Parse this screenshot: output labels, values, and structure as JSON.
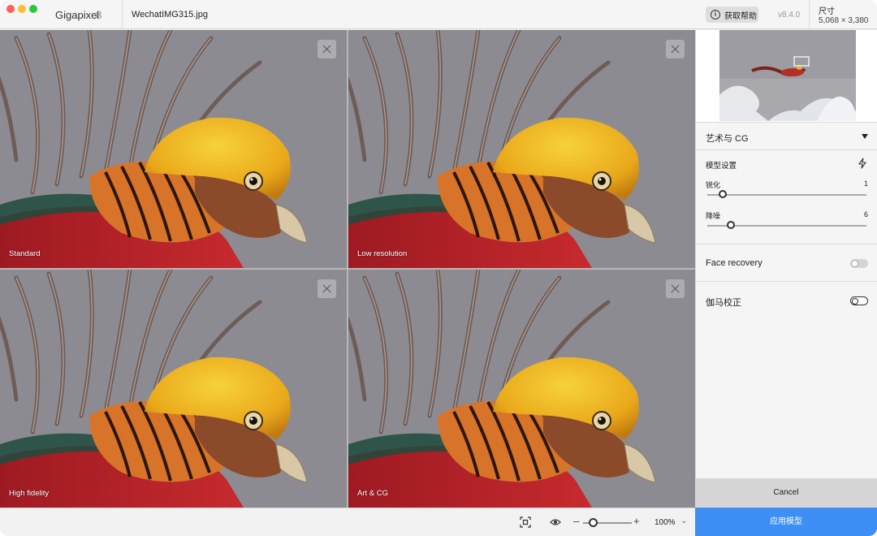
{
  "titlebar": {
    "app_name": "Gigapixel",
    "app_version_badge": "8",
    "file_name": "WechatIMG315.jpg",
    "help_label": "获取帮助",
    "version": "v8.4.0",
    "size_label": "尺寸",
    "size_value": "5,068 × 3,380"
  },
  "panels": [
    {
      "label": "Standard"
    },
    {
      "label": "Low resolution"
    },
    {
      "label": "High fidelity"
    },
    {
      "label": "Art & CG"
    }
  ],
  "bottombar": {
    "zoom_minus": "–",
    "zoom_plus": "+",
    "zoom_level": "100%",
    "zoom_fraction": 0.12
  },
  "sidebar": {
    "model_name": "艺术与 CG",
    "settings_title": "模型设置",
    "sliders": [
      {
        "label": "锐化",
        "value": "1",
        "fraction": 0.01
      },
      {
        "label": "降噪",
        "value": "6",
        "fraction": 0.06
      }
    ],
    "toggles": [
      {
        "label": "Face recovery",
        "on": false
      },
      {
        "label": "伽马校正",
        "on": false
      }
    ],
    "cancel_label": "Cancel",
    "apply_label": "应用模型"
  },
  "colors": {
    "accent": "#3d8ff5",
    "selected_outline": "#4a9dff"
  }
}
